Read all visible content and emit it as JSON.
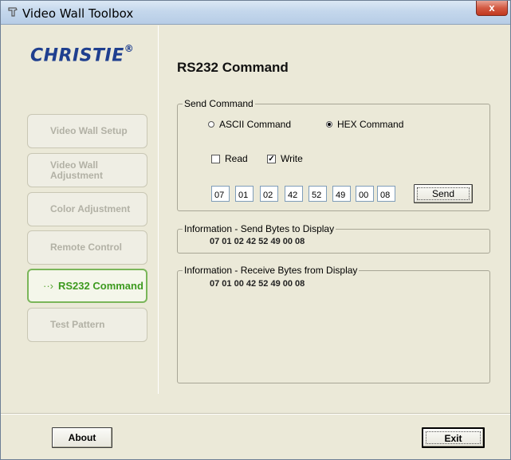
{
  "window": {
    "title": "Video Wall Toolbox",
    "close_label": "x"
  },
  "logo": {
    "text": "CHRISTIE",
    "mark": "®"
  },
  "nav": {
    "items": [
      {
        "label": "Video Wall Setup",
        "active": false
      },
      {
        "label": "Video Wall Adjustment",
        "active": false
      },
      {
        "label": "Color Adjustment",
        "active": false
      },
      {
        "label": "Remote Control",
        "active": false
      },
      {
        "label": "RS232 Command",
        "active": true
      },
      {
        "label": "Test Pattern",
        "active": false
      }
    ],
    "active_arrow": "··›"
  },
  "main": {
    "title": "RS232 Command",
    "send_group": {
      "title": "Send Command",
      "ascii_label": "ASCII Command",
      "hex_label": "HEX Command",
      "mode_selected": "HEX Command",
      "read_label": "Read",
      "read_checked": false,
      "write_label": "Write",
      "write_checked": true,
      "bytes": [
        "07",
        "01",
        "02",
        "42",
        "52",
        "49",
        "00",
        "08"
      ],
      "send_label": "Send"
    },
    "info_send": {
      "title": "Information - Send Bytes to Display",
      "value": "07 01 02 42 52 49 00 08"
    },
    "info_receive": {
      "title": "Information - Receive Bytes from Display",
      "value": "07 01 00 42 52 49 00 08"
    }
  },
  "footer": {
    "about_label": "About",
    "exit_label": "Exit"
  },
  "colors": {
    "window_bg": "#ebe9d8",
    "logo": "#1f3f8f",
    "active_nav": "#3d9a1f",
    "close_button": "#c1381f"
  }
}
